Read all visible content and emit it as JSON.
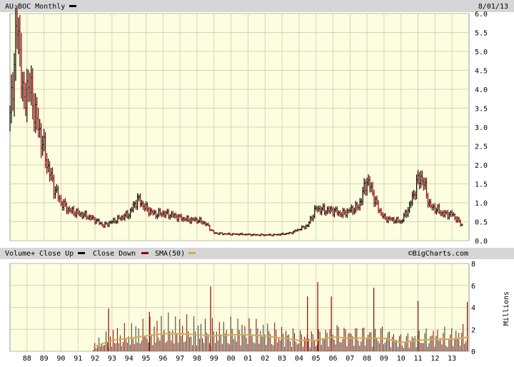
{
  "header": {
    "symbol_title": "AU:BOC Monthly",
    "date": "8/01/13"
  },
  "volume_header": {
    "volume_label": "Volume+",
    "close_up_label": "Close Up",
    "close_down_label": "Close Down",
    "sma_label": "SMA(50)",
    "brand": "©BigCharts.com"
  },
  "colors": {
    "panel_bg": "#fdfde0",
    "grid": "#c9c9a4",
    "header_bg": "#d6d6d6",
    "up": "#000000",
    "down": "#8b0000",
    "sma": "#d4aa55"
  },
  "chart_data": [
    {
      "type": "line",
      "title": "AU:BOC Monthly",
      "ylim": [
        0,
        6
      ],
      "y_tick_labels": [
        "0.0",
        "0.5",
        "1.0",
        "1.5",
        "2.0",
        "2.5",
        "3.0",
        "3.5",
        "4.0",
        "4.5",
        "5.0",
        "5.5",
        "6.0"
      ],
      "grid": true,
      "series": [
        {
          "x": [
            1987.0,
            1987.2,
            1987.4,
            1987.6,
            1987.8,
            1988.0,
            1988.3,
            1988.6,
            1988.9,
            1989.2,
            1989.6,
            1990.0,
            1990.5,
            1991.0,
            1991.5,
            1992.0,
            1992.5,
            1993.0,
            1993.5,
            1994.0,
            1994.5,
            1995.0,
            1995.5,
            1996.0,
            1996.5,
            1997.0,
            1997.5,
            1998.0,
            1998.5,
            1999.0,
            1999.5,
            2000.0,
            2000.5,
            2001.0,
            2001.5,
            2002.0,
            2002.5,
            2003.0,
            2003.5,
            2004.0,
            2004.5,
            2005.0,
            2005.5,
            2006.0,
            2006.5,
            2007.0,
            2007.5,
            2008.0,
            2008.3,
            2008.6,
            2009.0,
            2009.5,
            2010.0,
            2010.5,
            2011.0,
            2011.2,
            2011.4,
            2011.7,
            2012.0,
            2012.5,
            2013.0,
            2013.3,
            2013.6
          ],
          "values": [
            3.2,
            4.5,
            5.6,
            5.1,
            3.4,
            4.2,
            3.8,
            3.1,
            2.6,
            2.0,
            1.4,
            1.0,
            0.8,
            0.72,
            0.65,
            0.55,
            0.4,
            0.5,
            0.6,
            0.7,
            1.1,
            0.85,
            0.7,
            0.72,
            0.68,
            0.6,
            0.55,
            0.55,
            0.45,
            0.2,
            0.18,
            0.17,
            0.17,
            0.16,
            0.15,
            0.15,
            0.15,
            0.17,
            0.2,
            0.3,
            0.4,
            0.85,
            0.8,
            0.8,
            0.7,
            0.8,
            0.9,
            1.6,
            1.3,
            0.9,
            0.6,
            0.55,
            0.5,
            0.9,
            1.6,
            1.7,
            1.4,
            0.9,
            0.85,
            0.7,
            0.7,
            0.55,
            0.4
          ]
        }
      ]
    },
    {
      "type": "bar",
      "ylabel": "Millions",
      "ylim": [
        0,
        8
      ],
      "y_tick_labels": [
        "0",
        "2",
        "4",
        "6",
        "8"
      ],
      "x_tick_labels": [
        "88",
        "89",
        "90",
        "91",
        "92",
        "93",
        "94",
        "95",
        "96",
        "97",
        "98",
        "99",
        "00",
        "01",
        "02",
        "03",
        "04",
        "05",
        "06",
        "07",
        "08",
        "09",
        "10",
        "11",
        "12",
        "13"
      ],
      "volume_peaks": [
        {
          "x": 1992.8,
          "value": 3.9
        },
        {
          "x": 1995.2,
          "value": 3.6
        },
        {
          "x": 1998.8,
          "value": 5.9
        },
        {
          "x": 2004.5,
          "value": 5.0
        },
        {
          "x": 2005.1,
          "value": 6.3
        },
        {
          "x": 2005.9,
          "value": 5.0
        },
        {
          "x": 2008.4,
          "value": 5.8
        },
        {
          "x": 2011.0,
          "value": 4.6
        },
        {
          "x": 2013.9,
          "value": 4.5
        }
      ],
      "sma_x": [
        1991.9,
        1993.0,
        1994.0,
        1995.0,
        1996.0,
        1997.0,
        1998.0,
        1999.0,
        2000.0,
        2001.0,
        2002.0,
        2003.0,
        2004.0,
        2005.0,
        2006.0,
        2007.0,
        2008.0,
        2009.0,
        2010.0,
        2011.0,
        2012.0,
        2013.0,
        2014.0
      ],
      "sma_values": [
        0.4,
        1.0,
        1.2,
        1.4,
        1.6,
        1.6,
        1.5,
        1.4,
        1.5,
        1.5,
        1.4,
        1.2,
        1.0,
        1.0,
        1.3,
        1.2,
        1.2,
        1.2,
        0.8,
        1.0,
        1.1,
        1.1,
        1.3
      ]
    }
  ]
}
